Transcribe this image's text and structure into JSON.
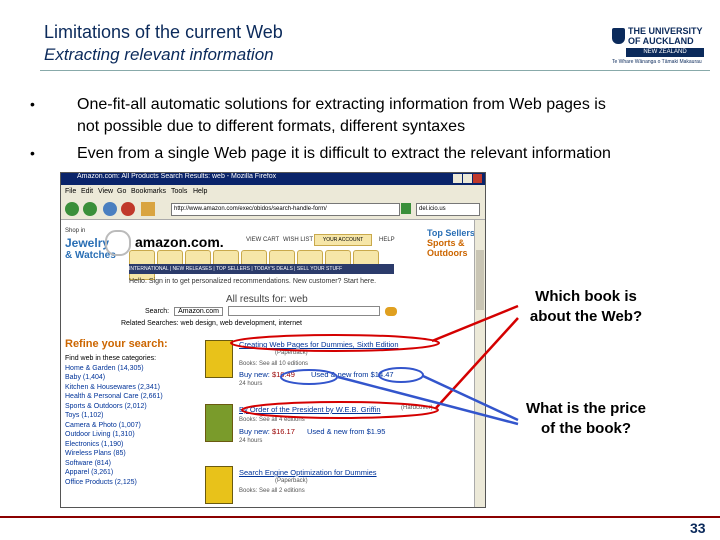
{
  "slide": {
    "title": "Limitations of the current Web",
    "subtitle": "Extracting relevant information",
    "page_number": "33"
  },
  "logo": {
    "line1": "THE UNIVERSITY",
    "line2": "OF AUCKLAND",
    "line3": "NEW ZEALAND",
    "line4": "Te Whare Wānanga o Tāmaki Makaurau"
  },
  "bullets": [
    {
      "line1": "One-fit-all automatic solutions for extracting information from Web pages is",
      "line2": "not possible due to different formats, different syntaxes"
    },
    {
      "line1": "Even from a single Web page it is difficult to extract the relevant information"
    }
  ],
  "browser": {
    "window_title": "Amazon.com: All Products Search Results: web - Mozilla Firefox",
    "menu": [
      "File",
      "Edit",
      "View",
      "Go",
      "Bookmarks",
      "Tools",
      "Help"
    ],
    "url": "http://www.amazon.com/exec/obidos/search-handle-form/",
    "search_value": "del.icio.us",
    "site": {
      "shop_in": "Shop in",
      "jewelry": "Jewelry",
      "watches": "& Watches",
      "logo": "amazon.com.",
      "view_cart": "VIEW CART",
      "wish_list": "WISH LIST",
      "your_account": "YOUR ACCOUNT",
      "help": "HELP",
      "nav_strip": "INTERNATIONAL | NEW RELEASES | TOP SELLERS | TODAY'S DEALS | SELL YOUR STUFF",
      "hello": "Hello. Sign in to get personalized recommendations. New customer? Start here.",
      "all_results": "All results for: web",
      "search_label": "Search:",
      "search_select": "Amazon.com",
      "related": "Related Searches: web design, web development, internet",
      "top_sellers": "Top Sellers",
      "sports": "Sports &",
      "outdoors": "Outdoors",
      "refine_title": "Refine your search:",
      "categories_intro": "Find web in these categories:",
      "categories": [
        "Home & Garden (14,305)",
        "Baby (1,404)",
        "Kitchen & Housewares (2,341)",
        "Health & Personal Care (2,661)",
        "Sports & Outdoors (2,012)",
        "Toys (1,102)",
        "Camera & Photo (1,007)",
        "Outdoor Living (1,310)",
        "Electronics (1,190)",
        "Wireless Plans (85)",
        "Software (814)",
        "Apparel (3,261)",
        "Office Products (2,125)"
      ],
      "books": [
        {
          "title": "Creating Web Pages for Dummies, Sixth Edition",
          "format": "(Paperback)",
          "meta": "Books: See all 10 editions",
          "buy_new": "Buy new:",
          "price": "$16.49",
          "used": "Used & new from $14.47",
          "availability": "24 hours"
        },
        {
          "title": "By Order of the President by W.E.B. Griffin",
          "format": "(Hardcover)",
          "meta": "Books: See all 4 editions",
          "buy_new": "Buy new:",
          "price": "$16.17",
          "used": "Used & new from $1.95",
          "availability": "24 hours"
        },
        {
          "title": "Search Engine Optimization for Dummies",
          "format": "(Paperback)",
          "meta": "Books: See all 2 editions",
          "buy_new": "",
          "price": "",
          "used": "",
          "availability": ""
        }
      ]
    }
  },
  "callouts": {
    "q1_line1": "Which book is",
    "q1_line2": "about the Web?",
    "q2_line1": "What is the price",
    "q2_line2": "of the book?"
  },
  "colors": {
    "arrow_red": "#d40000",
    "arrow_blue": "#3355cc",
    "title_blue": "#0b2a5b"
  }
}
